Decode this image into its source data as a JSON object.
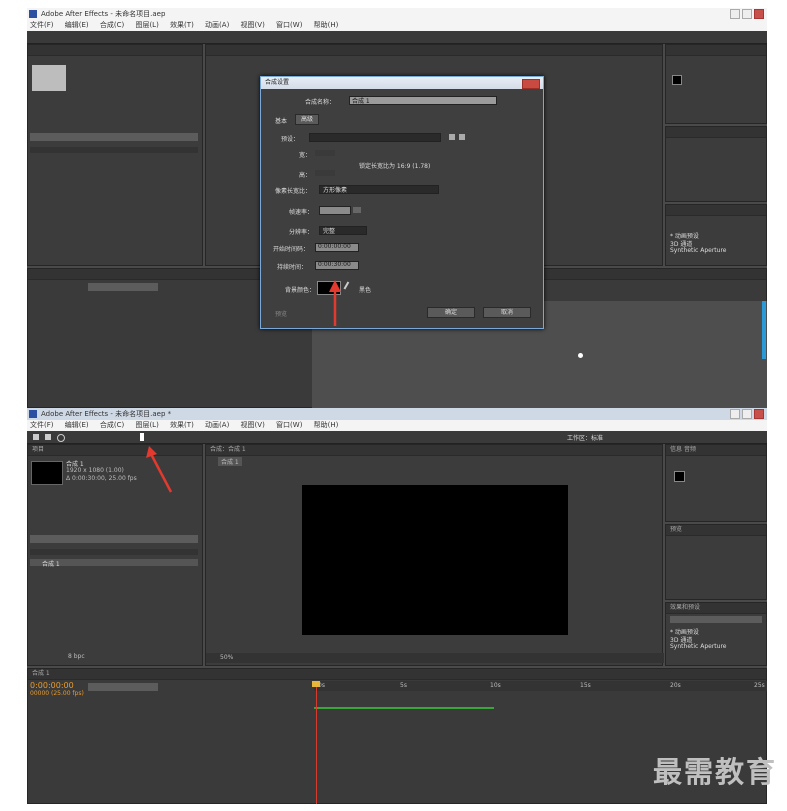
{
  "top": {
    "title": "Adobe After Effects - 未命名项目.aep",
    "menus": [
      "文件(F)",
      "编辑(E)",
      "合成(C)",
      "图层(L)",
      "效果(T)",
      "动画(A)",
      "视图(V)",
      "窗口(W)",
      "帮助(H)"
    ],
    "dialog": {
      "title": "合成设置",
      "name_label": "合成名称：",
      "name_value": "合成 1",
      "tabs": [
        "基本",
        "高级"
      ],
      "preset_label": "预设：",
      "width_label": "宽：",
      "height_label": "高：",
      "lock_text": "锁定长宽比为 16:9 (1.78)",
      "par_label": "像素长宽比：",
      "par_value": "方形像素",
      "fps_label": "帧速率：",
      "resolution_label": "分辨率：",
      "resolution_value": "完整",
      "start_label": "开始时间码：",
      "start_value": "0:00:00:00",
      "duration_label": "持续时间：",
      "duration_value": "0:00:30:00",
      "bg_label": "背景颜色：",
      "bg_name": "黑色",
      "preview_label": "预览",
      "ok": "确定",
      "cancel": "取消"
    }
  },
  "bottom": {
    "title": "Adobe After Effects - 未命名项目.aep *",
    "menus": [
      "文件(F)",
      "编辑(E)",
      "合成(C)",
      "图层(L)",
      "效果(T)",
      "动画(A)",
      "视图(V)",
      "窗口(W)",
      "帮助(H)"
    ],
    "workspace_label": "工作区：标准",
    "project_tab": "项目",
    "comp_name": "合成 1",
    "comp_info": "1920 x 1080 (1.00)",
    "comp_info2": "Δ 0:00:30:00, 25.00 fps",
    "comp_tab": "合成：合成 1",
    "comp_tab_small": "合成 1",
    "timeline_tab": "合成 1",
    "timecode": "0:00:00:00",
    "timecode_sub": "00000 (25.00 fps)",
    "info_tab": "信息",
    "audio_tab": "音频",
    "preview_tab": "预览",
    "effects_tab": "效果和预设",
    "effects_items": [
      "* 动画预设",
      "3D 通道",
      "Synthetic Aperture"
    ],
    "bpc": "8 bpc",
    "zoom": "50%",
    "ruler": [
      "0s",
      "5s",
      "10s",
      "15s",
      "20s",
      "25s"
    ]
  },
  "watermark": "最需教育",
  "colors": {
    "ae_bg": "#4a4a4a",
    "dialog_border": "#7aa8d8",
    "arrow_red": "#e23a2e",
    "timeline_green": "#3aa53a",
    "playhead_red": "#d83a2e",
    "accent_orange": "#e89b2c",
    "accent_blue": "#2d9ad8"
  }
}
